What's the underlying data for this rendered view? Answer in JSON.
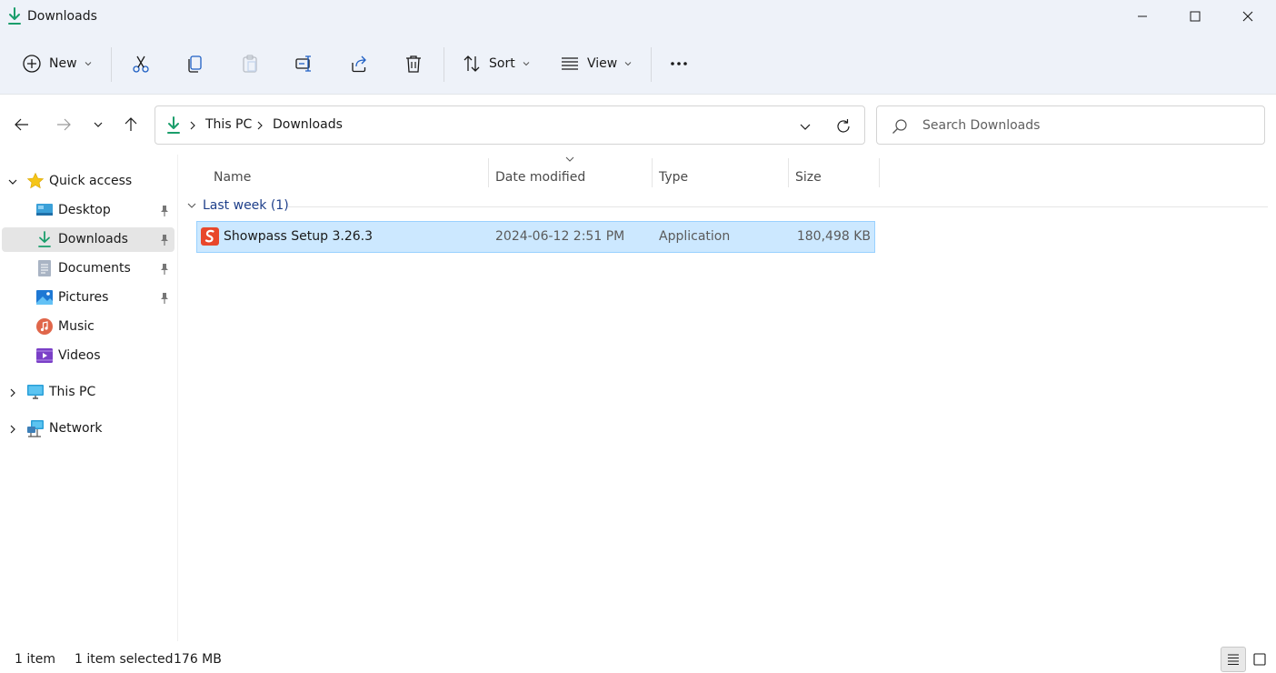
{
  "window": {
    "title": "Downloads",
    "controls": [
      "minimize",
      "maximize",
      "close"
    ]
  },
  "toolbar": {
    "new_label": "New",
    "sort_label": "Sort",
    "view_label": "View",
    "icons": [
      "new-icon",
      "cut-icon",
      "copy-icon",
      "paste-icon",
      "rename-icon",
      "share-icon",
      "delete-icon",
      "sort-icon",
      "view-icon",
      "more-icon"
    ]
  },
  "address": {
    "crumbs": [
      "This PC",
      "Downloads"
    ]
  },
  "search": {
    "placeholder": "Search Downloads"
  },
  "sidebar": {
    "quick_access": "Quick access",
    "items": [
      {
        "label": "Desktop",
        "pinned": true
      },
      {
        "label": "Downloads",
        "pinned": true,
        "selected": true
      },
      {
        "label": "Documents",
        "pinned": true
      },
      {
        "label": "Pictures",
        "pinned": true
      },
      {
        "label": "Music",
        "pinned": false
      },
      {
        "label": "Videos",
        "pinned": false
      }
    ],
    "this_pc": "This PC",
    "network": "Network"
  },
  "columns": {
    "name": "Name",
    "date": "Date modified",
    "type": "Type",
    "size": "Size"
  },
  "groups": [
    {
      "label": "Last week (1)",
      "files": [
        {
          "name": "Showpass Setup 3.26.3",
          "date": "2024-06-12 2:51 PM",
          "type": "Application",
          "size": "180,498 KB",
          "selected": true
        }
      ]
    }
  ],
  "status": {
    "count": "1 item",
    "selected": "1 item selected",
    "size": "176 MB"
  },
  "colors": {
    "accent_green": "#1a9e6b",
    "selection_bg": "#cce8ff",
    "selection_border": "#99d1ff",
    "group_text": "#1e3f8a",
    "chrome_bg": "#eef2f9"
  }
}
